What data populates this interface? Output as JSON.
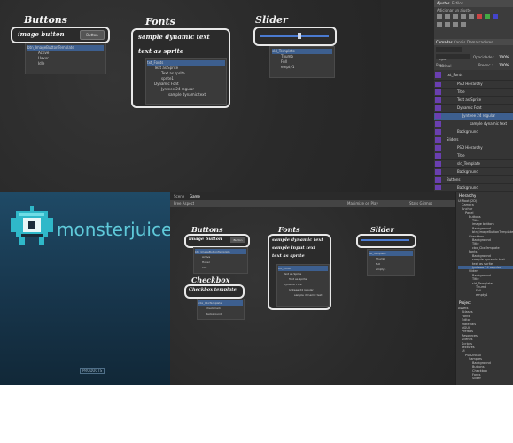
{
  "top_scene": {
    "panels": {
      "buttons": {
        "title": "Buttons",
        "row_label": "image button",
        "button_label": "Button",
        "tree": [
          "btn_ImageButtonTemplate",
          "Active",
          "Hover",
          "Idle"
        ]
      },
      "fonts": {
        "title": "Fonts",
        "line1": "sample dynamic text",
        "line2": "text as sprite",
        "tree": [
          "txt_Fonts",
          "Text as Sprite",
          "Text as sprite",
          "sprite1",
          "Dynamic Font",
          "Jynteee 24 regular",
          "sample dynamic text"
        ]
      },
      "slider": {
        "title": "Slider",
        "tree": [
          "sld_Template",
          "Thumb",
          "Full",
          "empty1"
        ]
      }
    }
  },
  "ps": {
    "menu_tabs": [
      "Ajustes",
      "Estilos"
    ],
    "add_label": "Adicionar un ajuste",
    "layer_tabs": [
      "Camadas",
      "Canais",
      "Demarcadores"
    ],
    "kind_label": "Tipo",
    "blend_mode": "Normal",
    "opacity_label": "Opacidade:",
    "opacity_value": "100%",
    "lock_label": "Bloq.:",
    "fill_label": "Preenc.:",
    "fill_value": "100%",
    "layers": [
      "txt_Fonts",
      "PSD Hierarchy",
      "Title",
      "Text as Sprite",
      "Dynamic Font",
      "Jynteee 24 regular",
      "sample dynamic text",
      "Background",
      "Sliders",
      "PSD Hierarchy",
      "Title",
      "sld_Template",
      "Background",
      "Buttons",
      "Background",
      "Camada 0"
    ]
  },
  "brand": {
    "name": "monsterjuice",
    "tagline": "PRODUCTS"
  },
  "unity": {
    "tabs": [
      "Scene",
      "Game"
    ],
    "toolbar_left": "Free Aspect",
    "toolbar_mid": "Maximize on Play",
    "toolbar_right": "Stats  Gizmos",
    "panels": {
      "buttons": {
        "title": "Buttons",
        "row_label": "image button",
        "button_label": "Button",
        "tree": [
          "btn_ImageButtonTemplate",
          "Active",
          "Hover",
          "Idle"
        ]
      },
      "checkbox": {
        "title": "Checkbox",
        "row_label": "Checkbox template",
        "tree": [
          "cbx_CbxTemplate",
          "Checkmark",
          "Background"
        ]
      },
      "fonts": {
        "title": "Fonts",
        "line1": "sample dynamic text",
        "line2": "sample input text",
        "line3": "text as sprite",
        "tree": [
          "txt_Fonts",
          "Text as Sprite",
          "Text as Sprite",
          "Dynamic Font",
          "Jynteee 24 regular",
          "sample dynamic text"
        ]
      },
      "slider": {
        "title": "Slider",
        "tree": [
          "sld_Template",
          "Thumb",
          "Full",
          "empty1"
        ]
      }
    },
    "hierarchy_title": "Hierarchy",
    "hierarchy": [
      "Ui Root (2D)",
      "Camera",
      "Anchor",
      "Panel",
      "Buttons",
      "Title",
      "image button",
      "Background",
      "btn_ImageButtonTemplate",
      "Checkbox",
      "Background",
      "Title",
      "cbx_CbxTemplate",
      "Fonts",
      "Background",
      "sample dynamic text",
      "text as sprite",
      "Jynteee 24 regular",
      "Slider",
      "Background",
      "Title",
      "sld_Template",
      "Thumb",
      "Full",
      "empty1"
    ],
    "project_title": "Project",
    "project": [
      "Assets",
      "Atlases",
      "Fonts",
      "Editor",
      "Materials",
      "NGUI",
      "Prefabs",
      "Resources",
      "Scenes",
      "Scripts",
      "Textures",
      "UI",
      "PSD2NGUI",
      "Samples",
      "Background",
      "Buttons",
      "Checkbox",
      "Fonts",
      "Slider"
    ]
  }
}
